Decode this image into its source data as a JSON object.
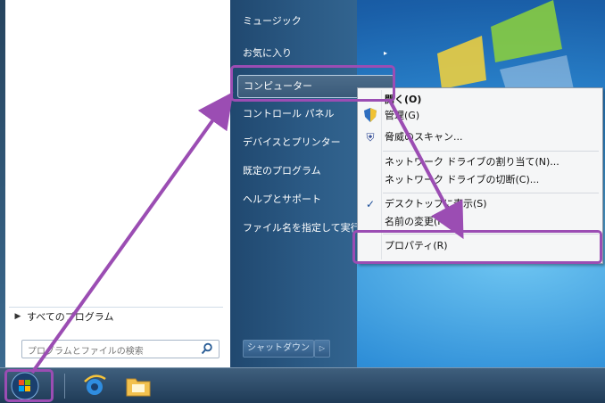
{
  "right_panel": {
    "items": [
      {
        "label": "ミュージック"
      },
      {
        "label": "お気に入り"
      },
      {
        "label": "コンピューター"
      },
      {
        "label": "コントロール パネル"
      },
      {
        "label": "デバイスとプリンター"
      },
      {
        "label": "既定のプログラム"
      },
      {
        "label": "ヘルプとサポート"
      },
      {
        "label": "ファイル名を指定して実行"
      }
    ],
    "shutdown_label": "シャットダウン"
  },
  "left_panel": {
    "all_programs": "すべてのプログラム",
    "search_placeholder": "プログラムとファイルの検索"
  },
  "context_menu": {
    "items": [
      {
        "label": "開く(O)"
      },
      {
        "label": "管理(G)"
      },
      {
        "label": "脅威のスキャン..."
      },
      {
        "label": "ネットワーク ドライブの割り当て(N)..."
      },
      {
        "label": "ネットワーク ドライブの切断(C)..."
      },
      {
        "label": "デスクトップに表示(S)"
      },
      {
        "label": "名前の変更(M)"
      },
      {
        "label": "プロパティ(R)"
      }
    ]
  },
  "colors": {
    "highlight": "#9b4db3",
    "desktop": "#2f8fd8",
    "panel": "#2b5a85"
  },
  "icons": [
    "windows-logo-icon",
    "start-orb-icon",
    "ie-icon",
    "explorer-icon",
    "shield-icon",
    "scan-icon",
    "check-icon",
    "search-icon"
  ]
}
